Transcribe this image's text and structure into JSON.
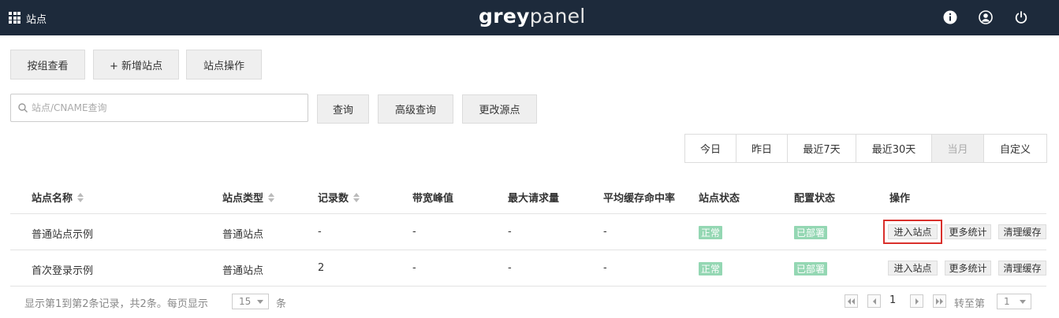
{
  "topbar": {
    "title": "站点",
    "logo_bold": "grey",
    "logo_light": "panel",
    "icons": [
      "info-icon",
      "user-icon",
      "power-icon"
    ]
  },
  "toolbar": {
    "group_view": "按组查看",
    "add_site": "+ 新增站点",
    "site_ops": "站点操作"
  },
  "search": {
    "placeholder": "站点/CNAME查询",
    "query": "查询",
    "advanced": "高级查询",
    "change_origin": "更改源点"
  },
  "date_range": {
    "options": [
      "今日",
      "昨日",
      "最近7天",
      "最近30天",
      "当月",
      "自定义"
    ],
    "active": "当月"
  },
  "table": {
    "headers": [
      "站点名称",
      "站点类型",
      "记录数",
      "带宽峰值",
      "最大请求量",
      "平均缓存命中率",
      "站点状态",
      "配置状态",
      "操作"
    ],
    "rows": [
      {
        "name": "普通站点示例",
        "type": "普通站点",
        "records": "-",
        "bandwidth": "-",
        "max_req": "-",
        "cache_hit": "-",
        "status": "正常",
        "config": "已部署",
        "actions": [
          "进入站点",
          "更多统计",
          "清理缓存"
        ]
      },
      {
        "name": "首次登录示例",
        "type": "普通站点",
        "records": "2",
        "bandwidth": "-",
        "max_req": "-",
        "cache_hit": "-",
        "status": "正常",
        "config": "已部署",
        "actions": [
          "进入站点",
          "更多统计",
          "清理缓存"
        ]
      }
    ]
  },
  "footer": {
    "summary": "显示第1到第2条记录，共2条。每页显示",
    "page_size": "15",
    "unit": "条",
    "current_page": "1",
    "goto_label": "转至第",
    "goto_value": "1"
  },
  "colors": {
    "topbar": "#1d2a3b",
    "badge": "#94d7b3",
    "highlight": "#d9302c"
  }
}
